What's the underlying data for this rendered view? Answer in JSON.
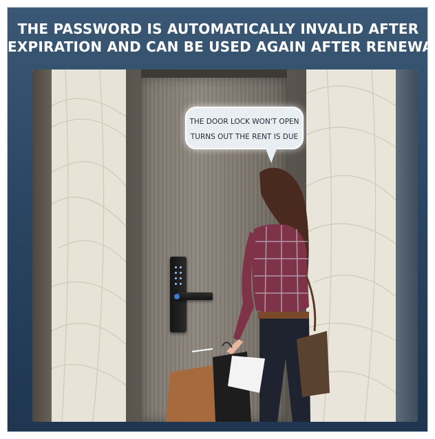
{
  "headline": {
    "line1": "THE PASSWORD IS AUTOMATICALLY INVALID AFTER",
    "line2": "EXPIRATION AND CAN BE USED AGAIN AFTER RENEWAL"
  },
  "speech_bubble": {
    "line1": "THE DOOR LOCK WON'T OPEN",
    "line2": "TURNS OUT THE RENT IS DUE"
  },
  "colors": {
    "background": "#2b4662",
    "headline_text": "#ffffff",
    "bubble_fill": "#e9eef3",
    "lock": "#151515"
  },
  "icons": [
    "smart-door-lock",
    "fingerprint-sensor",
    "keypad"
  ]
}
